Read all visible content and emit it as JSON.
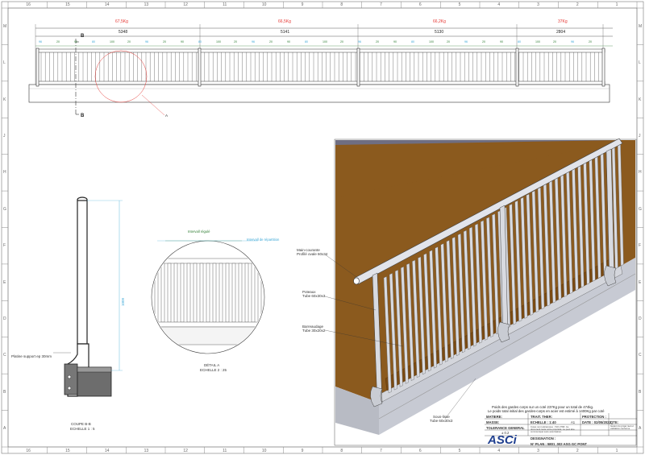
{
  "sheet": {
    "columns_top": [
      "16",
      "15",
      "14",
      "13",
      "12",
      "11",
      "10",
      "9",
      "8",
      "7",
      "6",
      "5",
      "4",
      "3",
      "2",
      "1"
    ],
    "rows_side": [
      "M",
      "L",
      "K",
      "J",
      "H",
      "G",
      "F",
      "E",
      "D",
      "C",
      "B",
      "A"
    ]
  },
  "top_view": {
    "section_markers": [
      "B",
      "B"
    ],
    "detail_marker": "A",
    "weights": [
      "67,5Kg",
      "66,5Kg",
      "66,2Kg",
      "37Kg"
    ],
    "lengths": [
      "5348",
      "5141",
      "5130",
      "2804"
    ],
    "spacing_labels": [
      "96",
      "20",
      "90",
      "80",
      "100",
      "20"
    ]
  },
  "section_view": {
    "height_dim": "1009",
    "plate_label": "Platine support ep 30mm",
    "caption_line1": "COUPE B-B",
    "caption_line2": "ECHELLE 1 : 5"
  },
  "detail_view": {
    "regular_interval": "Intervall régulé",
    "adjust_interval": "Intervall de répartition",
    "caption_line1": "DÉTAIL A",
    "caption_line2": "ECHELLE 2 : 25"
  },
  "iso_view": {
    "handrail_1": "Main-courante",
    "handrail_2": "Profilé ovale 60x34",
    "post_1": "Poteaux",
    "post_2": "Tube 60x30x3",
    "baluster_1": "Barreaudage",
    "baluster_2": "Tube 30x20x2",
    "bottom_rail_1": "Sous-lisse",
    "bottom_rail_2": "Tube 60x30x3"
  },
  "notes": {
    "line1": "Poids des gardes corps sur un coté 237Kg pour un total de 474kg.",
    "line2": "Le poids total initial des gardes-corps en acier est estimé à 1400Kg par coté"
  },
  "title_block": {
    "matiere": "MATIERE:",
    "masse": "MASSE:",
    "tolerance": "TOLERANCE GENERAL",
    "tolerance_val": "± 0.2",
    "trait": "TRAIT. THER:",
    "echelle": "ECHELLE : 1:40",
    "format": "A1",
    "protection": "PROTECTION :",
    "date": "DATE : 02/05/2022",
    "qte": "QTE:",
    "designation": "DESIGNATION :",
    "plan": "N° PLAN : 5801_002 ASG GC PONT",
    "logo": "ASCi",
    "warning": "Cotes non tolérancées : ISO 2768. Ce document reste notre propriété, ne peut être communiqué sans autorisation.",
    "recipient": "Garant du projet réel et validation conforme"
  }
}
